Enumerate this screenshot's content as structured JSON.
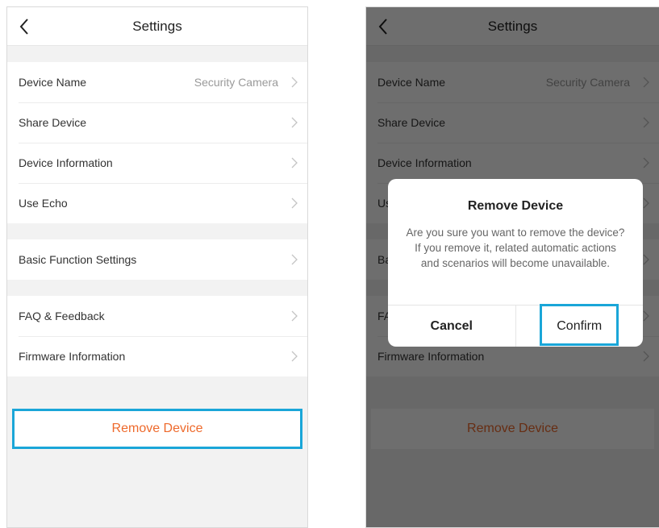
{
  "settings": {
    "title": "Settings",
    "device_name_label": "Device Name",
    "device_name_value": "Security Camera",
    "share_device": "Share Device",
    "device_information": "Device Information",
    "use_echo": "Use Echo",
    "basic_function_settings": "Basic Function Settings",
    "faq_feedback": "FAQ & Feedback",
    "firmware_information": "Firmware Information",
    "remove_device": "Remove Device"
  },
  "dialog": {
    "title": "Remove Device",
    "message": "Are you sure you want to remove the device? If you remove it, related automatic actions and scenarios will become unavailable.",
    "cancel": "Cancel",
    "confirm": "Confirm"
  },
  "colors": {
    "highlight": "#1aa6d8",
    "danger_text": "#ee6a2c"
  },
  "icons": {
    "back": "chevron-left-icon",
    "row_arrow": "chevron-right-icon"
  }
}
